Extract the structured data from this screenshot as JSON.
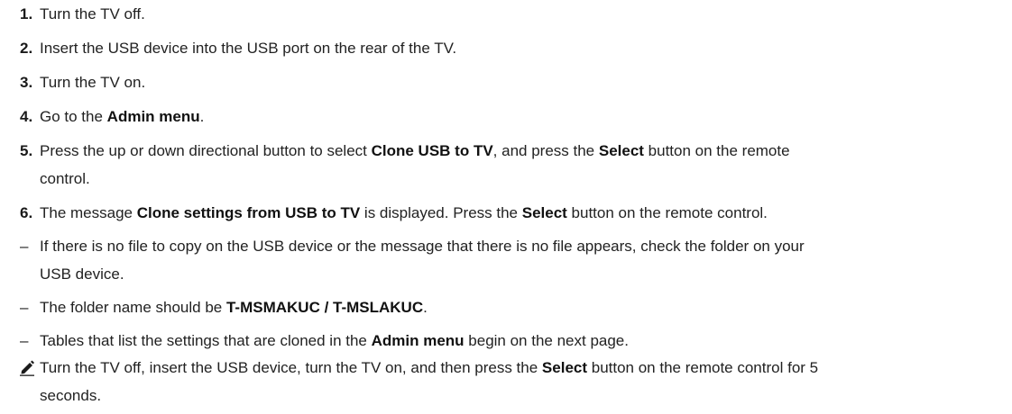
{
  "steps": [
    {
      "num": "1.",
      "parts": [
        "Turn the TV off."
      ]
    },
    {
      "num": "2.",
      "parts": [
        "Insert the USB device into the USB port on the rear of the TV."
      ]
    },
    {
      "num": "3.",
      "parts": [
        "Turn the TV on."
      ]
    },
    {
      "num": "4.",
      "parts": [
        "Go to the ",
        "Admin menu",
        "."
      ]
    },
    {
      "num": "5.",
      "parts": [
        "Press the up or down directional button to select ",
        "Clone USB to TV",
        ", and press the ",
        "Select",
        " button on the remote"
      ],
      "cont": "control."
    },
    {
      "num": "6.",
      "parts": [
        "The message ",
        "Clone settings from USB to TV",
        " is displayed. Press the ",
        "Select",
        " button on the remote control."
      ]
    }
  ],
  "notes": [
    {
      "dash": "–",
      "line1": "If there is no file to copy on the USB device or the message that there is no file appears, check the folder on your",
      "line2": "USB device."
    },
    {
      "dash": "–",
      "parts": [
        "The folder name should be ",
        "T-MSMAKUC / T-MSLAKUC",
        "."
      ]
    },
    {
      "dash": "–",
      "parts": [
        "Tables that list the settings that are cloned in the ",
        "Admin menu",
        " begin on the next page."
      ]
    }
  ],
  "tip": {
    "icon": "pencil-icon",
    "parts": [
      "Turn the TV off, insert the USB device, turn the TV on, and then press the ",
      "Select",
      " button on the remote control for 5"
    ],
    "cont": "seconds."
  }
}
